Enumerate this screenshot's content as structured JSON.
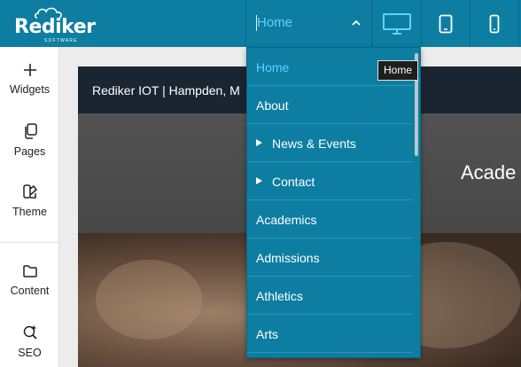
{
  "brand": {
    "name": "Rediker",
    "tagline": "SOFTWARE"
  },
  "page_selector": {
    "value": "Home"
  },
  "devices": [
    {
      "icon": "desktop-icon",
      "active": true
    },
    {
      "icon": "tablet-icon",
      "active": false
    },
    {
      "icon": "mobile-icon",
      "active": false
    }
  ],
  "tooltip": {
    "text": "Home"
  },
  "sidebar": {
    "items": [
      {
        "icon": "plus-icon",
        "label": "Widgets"
      },
      {
        "icon": "pages-icon",
        "label": "Pages"
      },
      {
        "icon": "palette-icon",
        "label": "Theme"
      },
      {
        "icon": "folder-icon",
        "label": "Content"
      },
      {
        "icon": "seo-search-icon",
        "label": "SEO"
      }
    ]
  },
  "dropdown": {
    "items": [
      {
        "label": "Home",
        "selected": true,
        "has_children": false
      },
      {
        "label": "About",
        "selected": false,
        "has_children": false
      },
      {
        "label": "News & Events",
        "selected": false,
        "has_children": true
      },
      {
        "label": "Contact",
        "selected": false,
        "has_children": true
      },
      {
        "label": "Academics",
        "selected": false,
        "has_children": false
      },
      {
        "label": "Admissions",
        "selected": false,
        "has_children": false
      },
      {
        "label": "Athletics",
        "selected": false,
        "has_children": false
      },
      {
        "label": "Arts",
        "selected": false,
        "has_children": false
      }
    ]
  },
  "preview": {
    "header_text": "Rediker IOT | Hampden, M",
    "banner_text": "Acade"
  },
  "colors": {
    "topbar": "#0d7ea2",
    "selected_text": "#5fd3ff",
    "preview_header": "#1b2531"
  }
}
